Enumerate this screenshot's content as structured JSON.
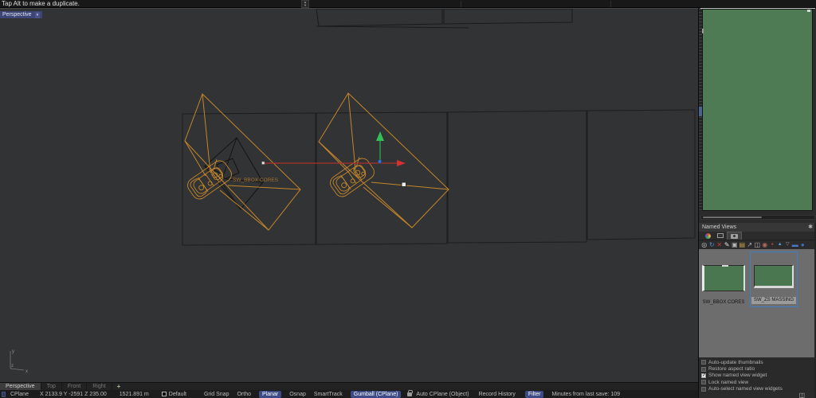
{
  "command_bar": {
    "prompt": "Tap Alt to make a duplicate.",
    "spinner_up": "▲",
    "spinner_down": "▼"
  },
  "viewport": {
    "label": "Perspective",
    "dropdown_icon": "▾",
    "scene_label": "SW_BBOX CORES",
    "axis": {
      "x": "x",
      "y": "y",
      "z": "z"
    }
  },
  "viewport_tabs": {
    "tabs": [
      {
        "label": "Perspective",
        "active": true
      },
      {
        "label": "Top",
        "active": false
      },
      {
        "label": "Front",
        "active": false
      },
      {
        "label": "Right",
        "active": false
      }
    ],
    "add_button": "+"
  },
  "status_bar": {
    "cplane": "CPlane",
    "coordinates": "X 2133.9 Y -2591 Z 235.00",
    "distance": "1521.891 m",
    "layer_label": "Default",
    "toggles": [
      {
        "label": "Grid Snap",
        "active": false
      },
      {
        "label": "Ortho",
        "active": false
      },
      {
        "label": "Planar",
        "active": true
      },
      {
        "label": "Osnap",
        "active": false
      },
      {
        "label": "SmartTrack",
        "active": false
      },
      {
        "label": "Gumball (CPlane)",
        "active": true
      },
      {
        "label": "Auto CPlane (Object)",
        "active": false
      },
      {
        "label": "Record History",
        "active": false
      },
      {
        "label": "Filter",
        "active": true
      }
    ],
    "save_info": "Minutes from last save: 109"
  },
  "named_views_panel": {
    "title": "Named Views",
    "gear_icon": "✱",
    "tab_icons": [
      {
        "name": "display-mode-tab"
      },
      {
        "name": "screen-tab"
      },
      {
        "name": "named-views-tab",
        "selected": true
      }
    ],
    "toolbar_icons": [
      {
        "name": "save-view-icon",
        "glyph": "◎",
        "color": "#c8c8c8"
      },
      {
        "name": "restore-view-icon",
        "glyph": "↻",
        "color": "#4f8fd8"
      },
      {
        "name": "delete-view-icon",
        "glyph": "✕",
        "color": "#cc3b3b"
      },
      {
        "name": "rename-view-icon",
        "glyph": "✎",
        "color": "#e0e0e0"
      },
      {
        "name": "copy-view-icon",
        "glyph": "▣",
        "color": "#b8b8b8"
      },
      {
        "name": "import-views-icon",
        "glyph": "▤",
        "color": "#c9a24a"
      },
      {
        "name": "export-views-icon",
        "glyph": "↗",
        "color": "#b8b8b8"
      },
      {
        "name": "paste-view-icon",
        "glyph": "◫",
        "color": "#b8b8b8"
      },
      {
        "name": "widget-view-icon",
        "glyph": "◉",
        "color": "#b06a5a"
      },
      {
        "name": "marker-icon",
        "glyph": "●",
        "color": "#c04848"
      },
      {
        "name": "sort-up-icon",
        "glyph": "▲",
        "color": "#4aa3d8"
      },
      {
        "name": "sort-down-icon",
        "glyph": "▽",
        "color": "#9a9a9a"
      },
      {
        "name": "list-style-icon",
        "glyph": "▬",
        "color": "#4a78c8"
      },
      {
        "name": "globe-icon",
        "glyph": "●",
        "color": "#3f6fc0"
      }
    ],
    "items": [
      {
        "label": "SW_BBOX CORES",
        "selected": false
      },
      {
        "label": "SW_ZS MASSING",
        "selected": true
      }
    ],
    "options": [
      {
        "label": "Auto-update thumbnails",
        "checked": false
      },
      {
        "label": "Restore aspect ratio",
        "checked": false
      },
      {
        "label": "Show named view widget",
        "checked": true
      },
      {
        "label": "Lock named view",
        "checked": false
      },
      {
        "label": "Auto-select named view widgets",
        "checked": false
      }
    ],
    "detail_icon": "◫"
  },
  "colors": {
    "viewport_background": "#323334",
    "wireframe_orange": "#c5862b",
    "preview_green": "#4e7a54",
    "selection_blue": "#3c4b85",
    "thumbnail_selection_blue": "#3f7fc4",
    "gumball_red": "#cf3333",
    "gumball_green": "#35c057",
    "gumball_blue": "#3a6fd8"
  }
}
